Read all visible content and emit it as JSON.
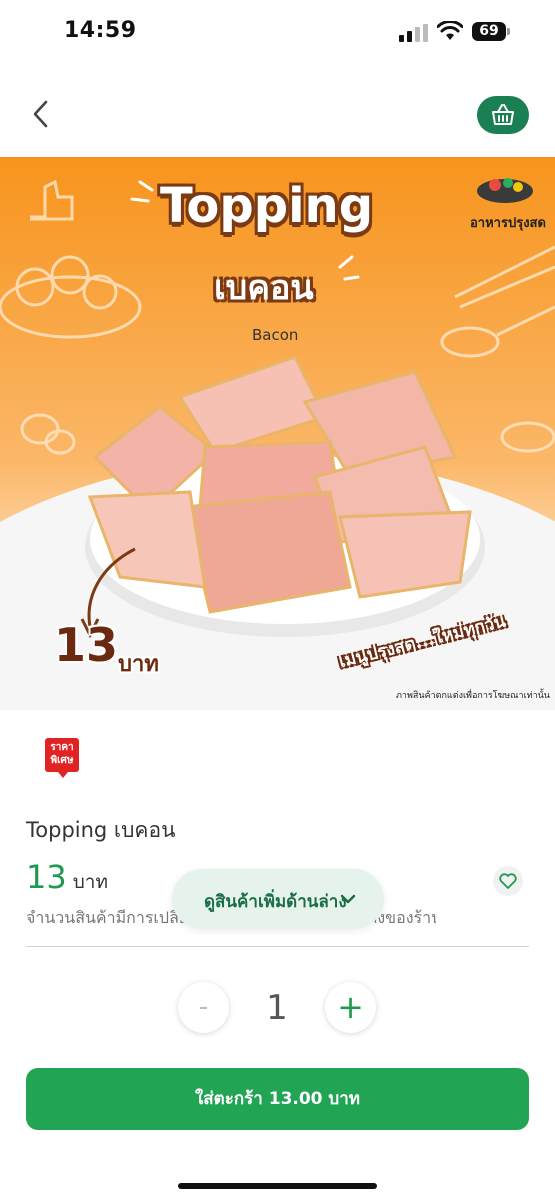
{
  "status_bar": {
    "time": "14:59",
    "battery": "69"
  },
  "header": {
    "back_icon": "chevron-left-icon",
    "cart_icon": "basket-icon"
  },
  "hero": {
    "title": "Topping",
    "subtitle": "เบคอน",
    "subtitle_en": "Bacon",
    "brand": "อาหารปรุงสด",
    "price_number": "13",
    "price_unit": "บาท",
    "tagline": "เมนูปรุงสด...ใหม่ทุกวัน",
    "disclaimer": "ภาพสินค้าตกแต่งเพื่อการโฆษณาเท่านั้น"
  },
  "promo_badge": {
    "line1": "ราคา",
    "line2": "พิเศษ"
  },
  "product": {
    "name": "Topping เบคอน",
    "price": "13",
    "price_unit": "บาท",
    "stock_note": "จำนวนสินค้ามีการเปลี่ยนแปลงขึ้นอยู่กับสินค้าคงคลังของร้าน"
  },
  "more_products": {
    "label": "ดูสินค้าเพิ่มด้านล่าง",
    "icon": "chevron-down-icon"
  },
  "quantity": {
    "minus": "-",
    "value": "1",
    "plus": "+"
  },
  "add_to_cart": {
    "label": "ใส่ตะกร้า 13.00 บาท"
  },
  "colors": {
    "brand_green": "#21a453",
    "dark_green": "#1a7f52",
    "hero_orange": "#f7941d"
  }
}
